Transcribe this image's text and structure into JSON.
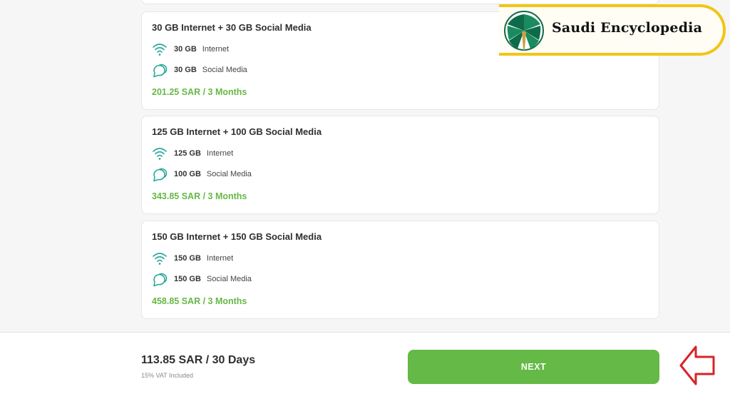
{
  "plans": [
    {
      "title": "30 GB Internet + 30 GB Social Media",
      "internet_amount": "30 GB",
      "internet_label": "Internet",
      "social_amount": "30 GB",
      "social_label": "Social Media",
      "price": "201.25 SAR /  3 Months"
    },
    {
      "title": "125 GB Internet + 100 GB Social Media",
      "internet_amount": "125 GB",
      "internet_label": "Internet",
      "social_amount": "100 GB",
      "social_label": "Social Media",
      "price": "343.85 SAR /  3 Months"
    },
    {
      "title": "150 GB Internet + 150 GB Social Media",
      "internet_amount": "150 GB",
      "internet_label": "Internet",
      "social_amount": "150 GB",
      "social_label": "Social Media",
      "price": "458.85 SAR /  3 Months"
    }
  ],
  "footer": {
    "total": "113.85 SAR / 30 Days",
    "vat_note": "15% VAT Included",
    "next_label": "NEXT"
  },
  "watermark": {
    "text": "Saudi Encyclopedia"
  },
  "colors": {
    "accent_green": "#65b946",
    "icon_teal": "#2aa89a",
    "arrow_red": "#d9232a"
  },
  "icons": {
    "internet": "wifi-icon",
    "social": "chat-bubbles-icon",
    "pointer": "arrow-left-icon"
  }
}
